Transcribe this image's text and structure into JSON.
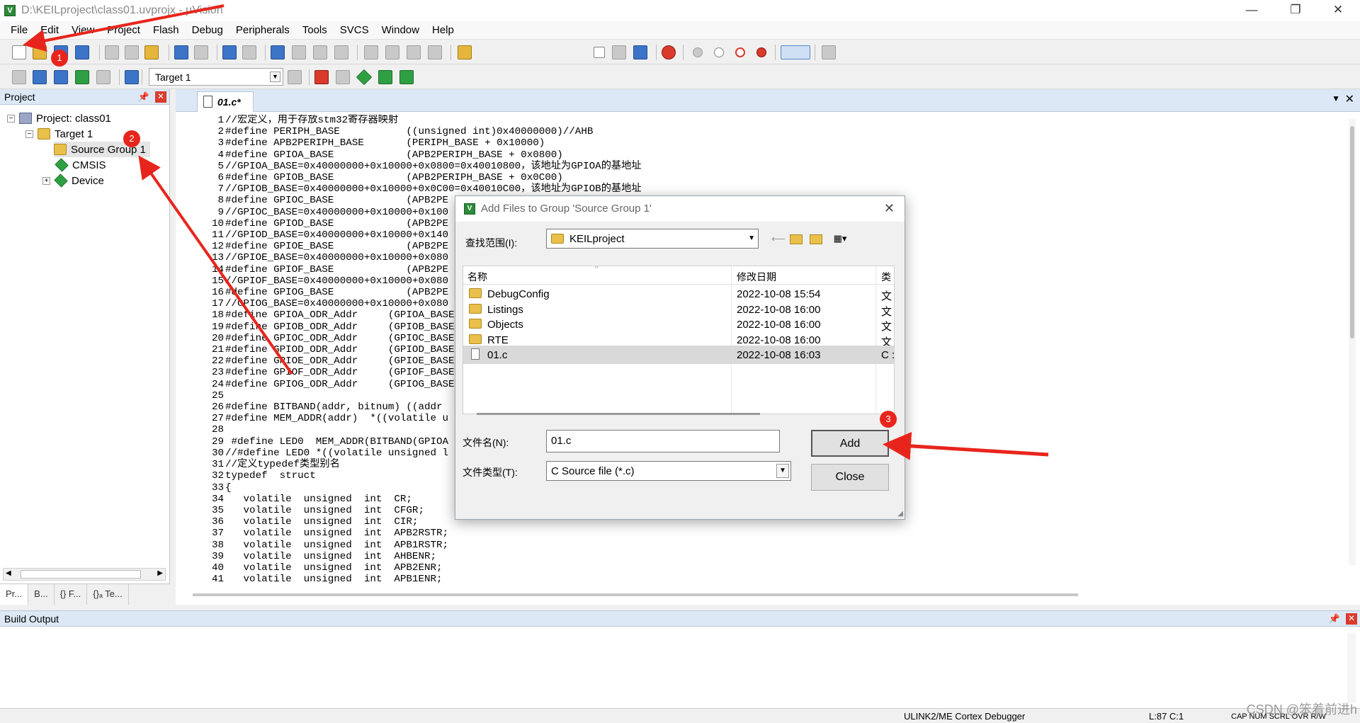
{
  "window": {
    "title": "D:\\KEILproject\\class01.uvprojx - µVision",
    "controls": {
      "minimize": "—",
      "maximize": "❐",
      "close": "✕"
    }
  },
  "menubar": [
    "File",
    "Edit",
    "View",
    "Project",
    "Flash",
    "Debug",
    "Peripherals",
    "Tools",
    "SVCS",
    "Window",
    "Help"
  ],
  "toolbar2": {
    "target": "Target 1"
  },
  "project_panel": {
    "title": "Project",
    "tree": {
      "project": "Project: class01",
      "target": "Target 1",
      "group": "Source Group 1",
      "cmsis": "CMSIS",
      "device": "Device"
    },
    "tabs": [
      "Pr...",
      "B...",
      "{} F...",
      "{}ₐ Te..."
    ]
  },
  "editor": {
    "tab": "01.c*",
    "lines": [
      {
        "n": "1",
        "c": "//宏定义，用于存放stm32寄存器映射",
        "t": "cmt"
      },
      {
        "n": "2",
        "c": "#define PERIPH_BASE           ((unsigned int)0x40000000)//AHB",
        "t": "code"
      },
      {
        "n": "3",
        "c": "#define APB2PERIPH_BASE       (PERIPH_BASE + 0x10000)",
        "t": "code"
      },
      {
        "n": "4",
        "c": "#define GPIOA_BASE            (APB2PERIPH_BASE + 0x0800)",
        "t": "code"
      },
      {
        "n": "5",
        "c": "//GPIOA_BASE=0x40000000+0x10000+0x0800=0x40010800，该地址为GPIOA的基地址",
        "t": "cmt"
      },
      {
        "n": "6",
        "c": "#define GPIOB_BASE            (APB2PERIPH_BASE + 0x0C00)",
        "t": "code"
      },
      {
        "n": "7",
        "c": "//GPIOB_BASE=0x40000000+0x10000+0x0C00=0x40010C00，该地址为GPIOB的基地址",
        "t": "cmt"
      },
      {
        "n": "8",
        "c": "#define GPIOC_BASE            (APB2PE",
        "t": "code"
      },
      {
        "n": "9",
        "c": "//GPIOC_BASE=0x40000000+0x10000+0x100",
        "t": "cmt"
      },
      {
        "n": "10",
        "c": "#define GPIOD_BASE            (APB2PE",
        "t": "code"
      },
      {
        "n": "11",
        "c": "//GPIOD_BASE=0x40000000+0x10000+0x140",
        "t": "cmt"
      },
      {
        "n": "12",
        "c": "#define GPIOE_BASE            (APB2PE",
        "t": "code"
      },
      {
        "n": "13",
        "c": "//GPIOE_BASE=0x40000000+0x10000+0x080",
        "t": "cmt"
      },
      {
        "n": "14",
        "c": "#define GPIOF_BASE            (APB2PE",
        "t": "code"
      },
      {
        "n": "15",
        "c": "//GPIOF_BASE=0x40000000+0x10000+0x080",
        "t": "cmt"
      },
      {
        "n": "16",
        "c": "#define GPIOG_BASE            (APB2PE",
        "t": "code"
      },
      {
        "n": "17",
        "c": "//GPIOG_BASE=0x40000000+0x10000+0x080",
        "t": "cmt"
      },
      {
        "n": "18",
        "c": "#define GPIOA_ODR_Addr     (GPIOA_BASE",
        "t": "code"
      },
      {
        "n": "19",
        "c": "#define GPIOB_ODR_Addr     (GPIOB_BASE",
        "t": "code"
      },
      {
        "n": "20",
        "c": "#define GPIOC_ODR_Addr     (GPIOC_BASE",
        "t": "code"
      },
      {
        "n": "21",
        "c": "#define GPIOD_ODR_Addr     (GPIOD_BASE",
        "t": "code"
      },
      {
        "n": "22",
        "c": "#define GPIOE_ODR_Addr     (GPIOE_BASE",
        "t": "code"
      },
      {
        "n": "23",
        "c": "#define GPIOF_ODR_Addr     (GPIOF_BASE",
        "t": "code"
      },
      {
        "n": "24",
        "c": "#define GPIOG_ODR_Addr     (GPIOG_BASE",
        "t": "code"
      },
      {
        "n": "25",
        "c": "",
        "t": "code"
      },
      {
        "n": "26",
        "c": "#define BITBAND(addr, bitnum) ((addr",
        "t": "code"
      },
      {
        "n": "27",
        "c": "#define MEM_ADDR(addr)  *((volatile u",
        "t": "code"
      },
      {
        "n": "28",
        "c": "",
        "t": "code"
      },
      {
        "n": "29",
        "c": " #define LED0  MEM_ADDR(BITBAND(GPIOA",
        "t": "code"
      },
      {
        "n": "30",
        "c": "//#define LED0 *((volatile unsigned l",
        "t": "cmt"
      },
      {
        "n": "31",
        "c": "//定义typedef类型别名",
        "t": "cmt"
      },
      {
        "n": "32",
        "c": "typedef  struct",
        "t": "kw"
      },
      {
        "n": "33",
        "c": "{",
        "t": "code"
      },
      {
        "n": "34",
        "c": "   volatile  unsigned  int  CR;",
        "t": "decl"
      },
      {
        "n": "35",
        "c": "   volatile  unsigned  int  CFGR;",
        "t": "decl"
      },
      {
        "n": "36",
        "c": "   volatile  unsigned  int  CIR;",
        "t": "decl"
      },
      {
        "n": "37",
        "c": "   volatile  unsigned  int  APB2RSTR;",
        "t": "decl"
      },
      {
        "n": "38",
        "c": "   volatile  unsigned  int  APB1RSTR;",
        "t": "decl"
      },
      {
        "n": "39",
        "c": "   volatile  unsigned  int  AHBENR;",
        "t": "decl"
      },
      {
        "n": "40",
        "c": "   volatile  unsigned  int  APB2ENR;",
        "t": "decl"
      },
      {
        "n": "41",
        "c": "   volatile  unsigned  int  APB1ENR;",
        "t": "decl"
      }
    ]
  },
  "dialog": {
    "title": "Add Files to Group 'Source Group 1'",
    "lookin_label": "查找范围(I):",
    "lookin_value": "KEILproject",
    "columns": {
      "name": "名称",
      "date": "修改日期",
      "type": "类"
    },
    "files": [
      {
        "name": "DebugConfig",
        "date": "2022-10-08 15:54",
        "type": "文",
        "kind": "folder"
      },
      {
        "name": "Listings",
        "date": "2022-10-08 16:00",
        "type": "文",
        "kind": "folder"
      },
      {
        "name": "Objects",
        "date": "2022-10-08 16:00",
        "type": "文",
        "kind": "folder"
      },
      {
        "name": "RTE",
        "date": "2022-10-08 16:00",
        "type": "文",
        "kind": "folder"
      },
      {
        "name": "01.c",
        "date": "2022-10-08 16:03",
        "type": "C :",
        "kind": "file"
      }
    ],
    "filename_label": "文件名(N):",
    "filename_value": "01.c",
    "filetype_label": "文件类型(T):",
    "filetype_value": "C Source file (*.c)",
    "add_button": "Add",
    "close_button": "Close"
  },
  "build_output": {
    "title": "Build Output"
  },
  "statusbar": {
    "debugger": "ULINK2/ME Cortex Debugger",
    "position": "L:87 C:1",
    "indicators": "CAP  NUM  SCRL  OVR  R/W"
  },
  "annotations": {
    "badge1": "1",
    "badge2": "2",
    "badge3": "3",
    "arrow_color": "#e8251c"
  },
  "watermark": "CSDN @笨着前进h"
}
